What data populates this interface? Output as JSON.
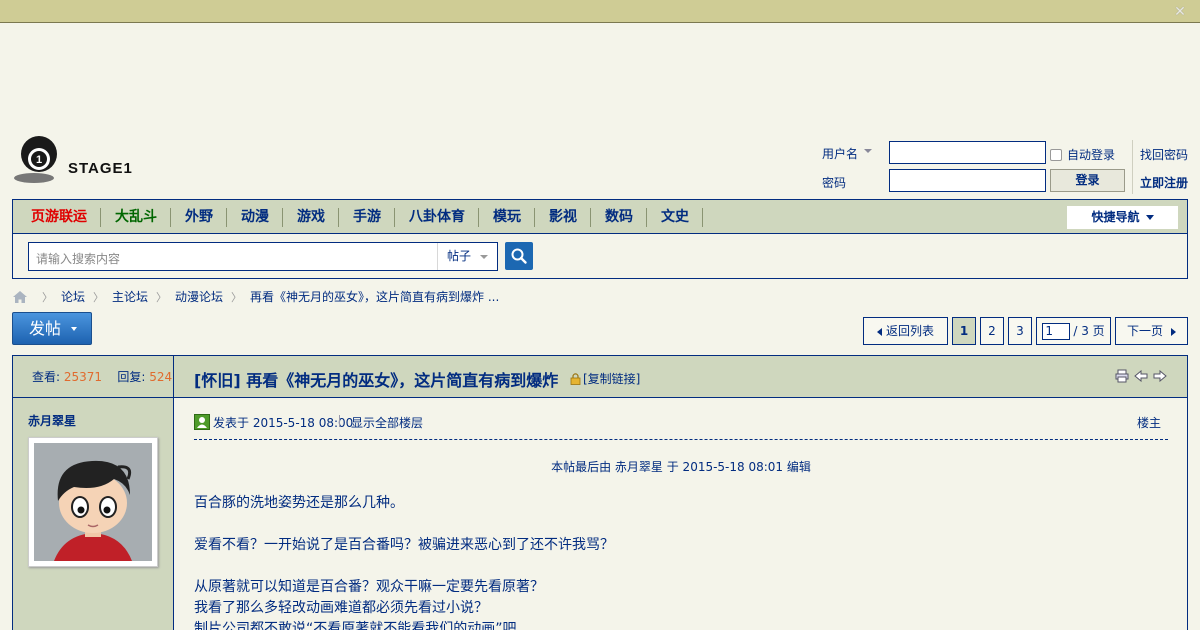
{
  "topbar": {
    "close_symbol": "✕"
  },
  "logo": {
    "text": "STAGE1",
    "digit": "1"
  },
  "login": {
    "username_label": "用户名",
    "password_label": "密码",
    "username_value": "",
    "password_value": "",
    "auto_login_label": "自动登录",
    "login_button": "登录",
    "find_password": "找回密码",
    "register": "立即注册"
  },
  "nav": {
    "items": [
      {
        "label": "页游联运",
        "color": "#e00000"
      },
      {
        "label": "大乱斗",
        "color": "#006600"
      },
      {
        "label": "外野"
      },
      {
        "label": "动漫"
      },
      {
        "label": "游戏"
      },
      {
        "label": "手游"
      },
      {
        "label": "八卦体育"
      },
      {
        "label": "模玩"
      },
      {
        "label": "影视"
      },
      {
        "label": "数码"
      },
      {
        "label": "文史"
      }
    ],
    "quick_nav": "快捷导航",
    "search_placeholder": "请输入搜索内容",
    "search_type": "帖子"
  },
  "breadcrumb": {
    "items": [
      "论坛",
      "主论坛",
      "动漫论坛",
      "再看《神无月的巫女》，这片简直有病到爆炸 ..."
    ]
  },
  "post_button": "发帖",
  "pagination": {
    "back": "返回列表",
    "pages": [
      "1",
      "2",
      "3"
    ],
    "current_page": "1",
    "total_text": "/ 3 页",
    "next": "下一页"
  },
  "thread": {
    "views_label": "查看:",
    "views": "25371",
    "replies_label": "回复:",
    "replies": "524",
    "title": "[怀旧] 再看《神无月的巫女》，这片简直有病到爆炸",
    "copy_link": "[复制链接]",
    "author": "赤月翠星",
    "posted_at": "发表于 2015-5-18 08:00",
    "show_all": "显示全部楼层",
    "floor": "楼主",
    "edit_note": "本帖最后由 赤月翠星 于 2015-5-18 08:01 编辑",
    "body": [
      "百合豚的洗地姿势还是那么几种。",
      "",
      "爱看不看？一开始说了是百合番吗？被骗进来恶心到了还不许我骂？",
      "",
      "从原著就可以知道是百合番？观众干嘛一定要先看原著？",
      "我看了那么多轻改动画难道都必须先看过小说？",
      "制片公司都不敢说“不看原著就不能看我们的动画”吧"
    ]
  },
  "colors": {
    "accent": "#022c80",
    "header_bg": "#cfd7be",
    "page_bg": "#f4f4ea",
    "topbar": "#cfcc95",
    "stat_number": "#e06b2e"
  }
}
